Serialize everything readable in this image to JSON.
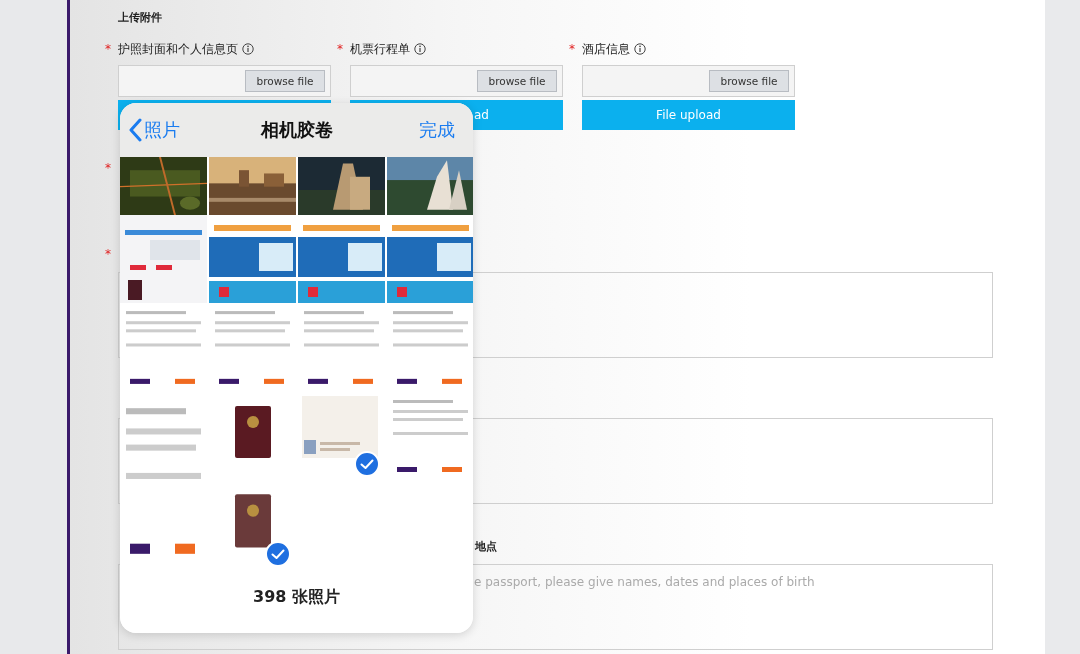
{
  "upload": {
    "heading": "上传附件",
    "items": [
      {
        "mark": "*",
        "label": "护照封面和个人信息页",
        "browse": "browse file"
      },
      {
        "mark": "*",
        "label": "机票行程单",
        "browse": "browse file",
        "upload": "ad"
      },
      {
        "mark": "*",
        "label": "酒店信息",
        "browse": "browse file",
        "upload": "File upload"
      }
    ]
  },
  "fields": [
    {
      "kind": "mark",
      "mark": "*"
    },
    {
      "kind": "textarea",
      "mark": "*"
    },
    {
      "kind": "textarea"
    },
    {
      "kind": "textarea",
      "label": "地点",
      "placeholder": "e passport, please give names, dates and places of birth"
    }
  ],
  "picker": {
    "back": "照片",
    "title": "相机胶卷",
    "done": "完成",
    "count": "398 张照片",
    "photos": [
      {
        "selected": false
      },
      {
        "selected": false
      },
      {
        "selected": false
      },
      {
        "selected": false
      },
      {
        "selected": false
      },
      {
        "selected": false
      },
      {
        "selected": false
      },
      {
        "selected": false
      },
      {
        "selected": false
      },
      {
        "selected": false
      },
      {
        "selected": false
      },
      {
        "selected": false
      },
      {
        "selected": false,
        "tall": true
      },
      {
        "selected": false
      },
      {
        "selected": true
      },
      {
        "selected": false
      },
      {
        "selected": true
      }
    ]
  }
}
